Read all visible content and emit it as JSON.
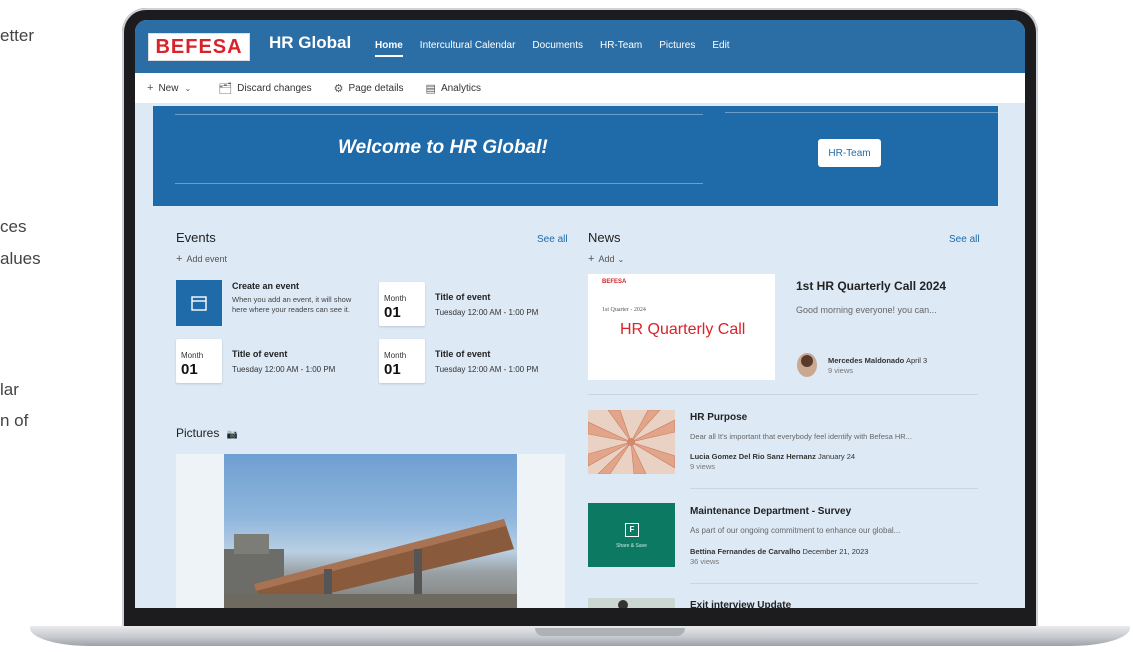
{
  "left_fragments": [
    "etter",
    "ces",
    "alues",
    "lar",
    "n of"
  ],
  "brand": {
    "logo_text": "BEFESA",
    "site_title": "HR Global",
    "nav_color": "#2b6ea6",
    "logo_color": "#d8232a"
  },
  "nav": {
    "items": [
      {
        "label": "Home",
        "active": true
      },
      {
        "label": "Intercultural Calendar"
      },
      {
        "label": "Documents"
      },
      {
        "label": "HR-Team"
      },
      {
        "label": "Pictures"
      },
      {
        "label": "Edit"
      }
    ]
  },
  "commandbar": {
    "new_label": "New",
    "discard_label": "Discard changes",
    "page_details_label": "Page details",
    "analytics_label": "Analytics"
  },
  "hero": {
    "title": "Welcome to HR Global!",
    "button_label": "HR-Team"
  },
  "events": {
    "title": "Events",
    "see_all": "See all",
    "add_label": "Add event",
    "create": {
      "title": "Create an event",
      "desc": "When you add an event, it will show here where your readers can see it."
    },
    "items": [
      {
        "month": "Month",
        "day": "01",
        "title": "Title of event",
        "time": "Tuesday 12:00 AM - 1:00 PM"
      },
      {
        "month": "Month",
        "day": "01",
        "title": "Title of event",
        "time": "Tuesday 12:00 AM - 1:00 PM"
      },
      {
        "month": "Month",
        "day": "01",
        "title": "Title of event",
        "time": "Tuesday 12:00 AM - 1:00 PM"
      }
    ]
  },
  "pictures": {
    "title": "Pictures"
  },
  "news": {
    "title": "News",
    "see_all": "See all",
    "add_label": "Add",
    "featured": {
      "thumb_logo": "BEFESA",
      "thumb_small": "1st Quarter - 2024",
      "thumb_title": "HR Quarterly Call",
      "title": "1st HR Quarterly Call 2024",
      "desc": "Good morning everyone! you can...",
      "author": "Mercedes Maldonado",
      "date": "April 3",
      "views": "9 views"
    },
    "items": [
      {
        "title": "HR Purpose",
        "desc": "Dear all It's important that everybody feel identify with Befesa HR...",
        "author": "Lucia Gomez Del Rio Sanz Hernanz",
        "date": "January 24",
        "views": "9 views"
      },
      {
        "title": "Maintenance Department - Survey",
        "desc": "As part of our ongoing commitment to enhance our global...",
        "author": "Bettina Fernandes de Carvalho",
        "date": "December 21, 2023",
        "views": "36 views",
        "thumb_label": "Share & Save"
      },
      {
        "title": "Exit interview Update"
      }
    ]
  }
}
